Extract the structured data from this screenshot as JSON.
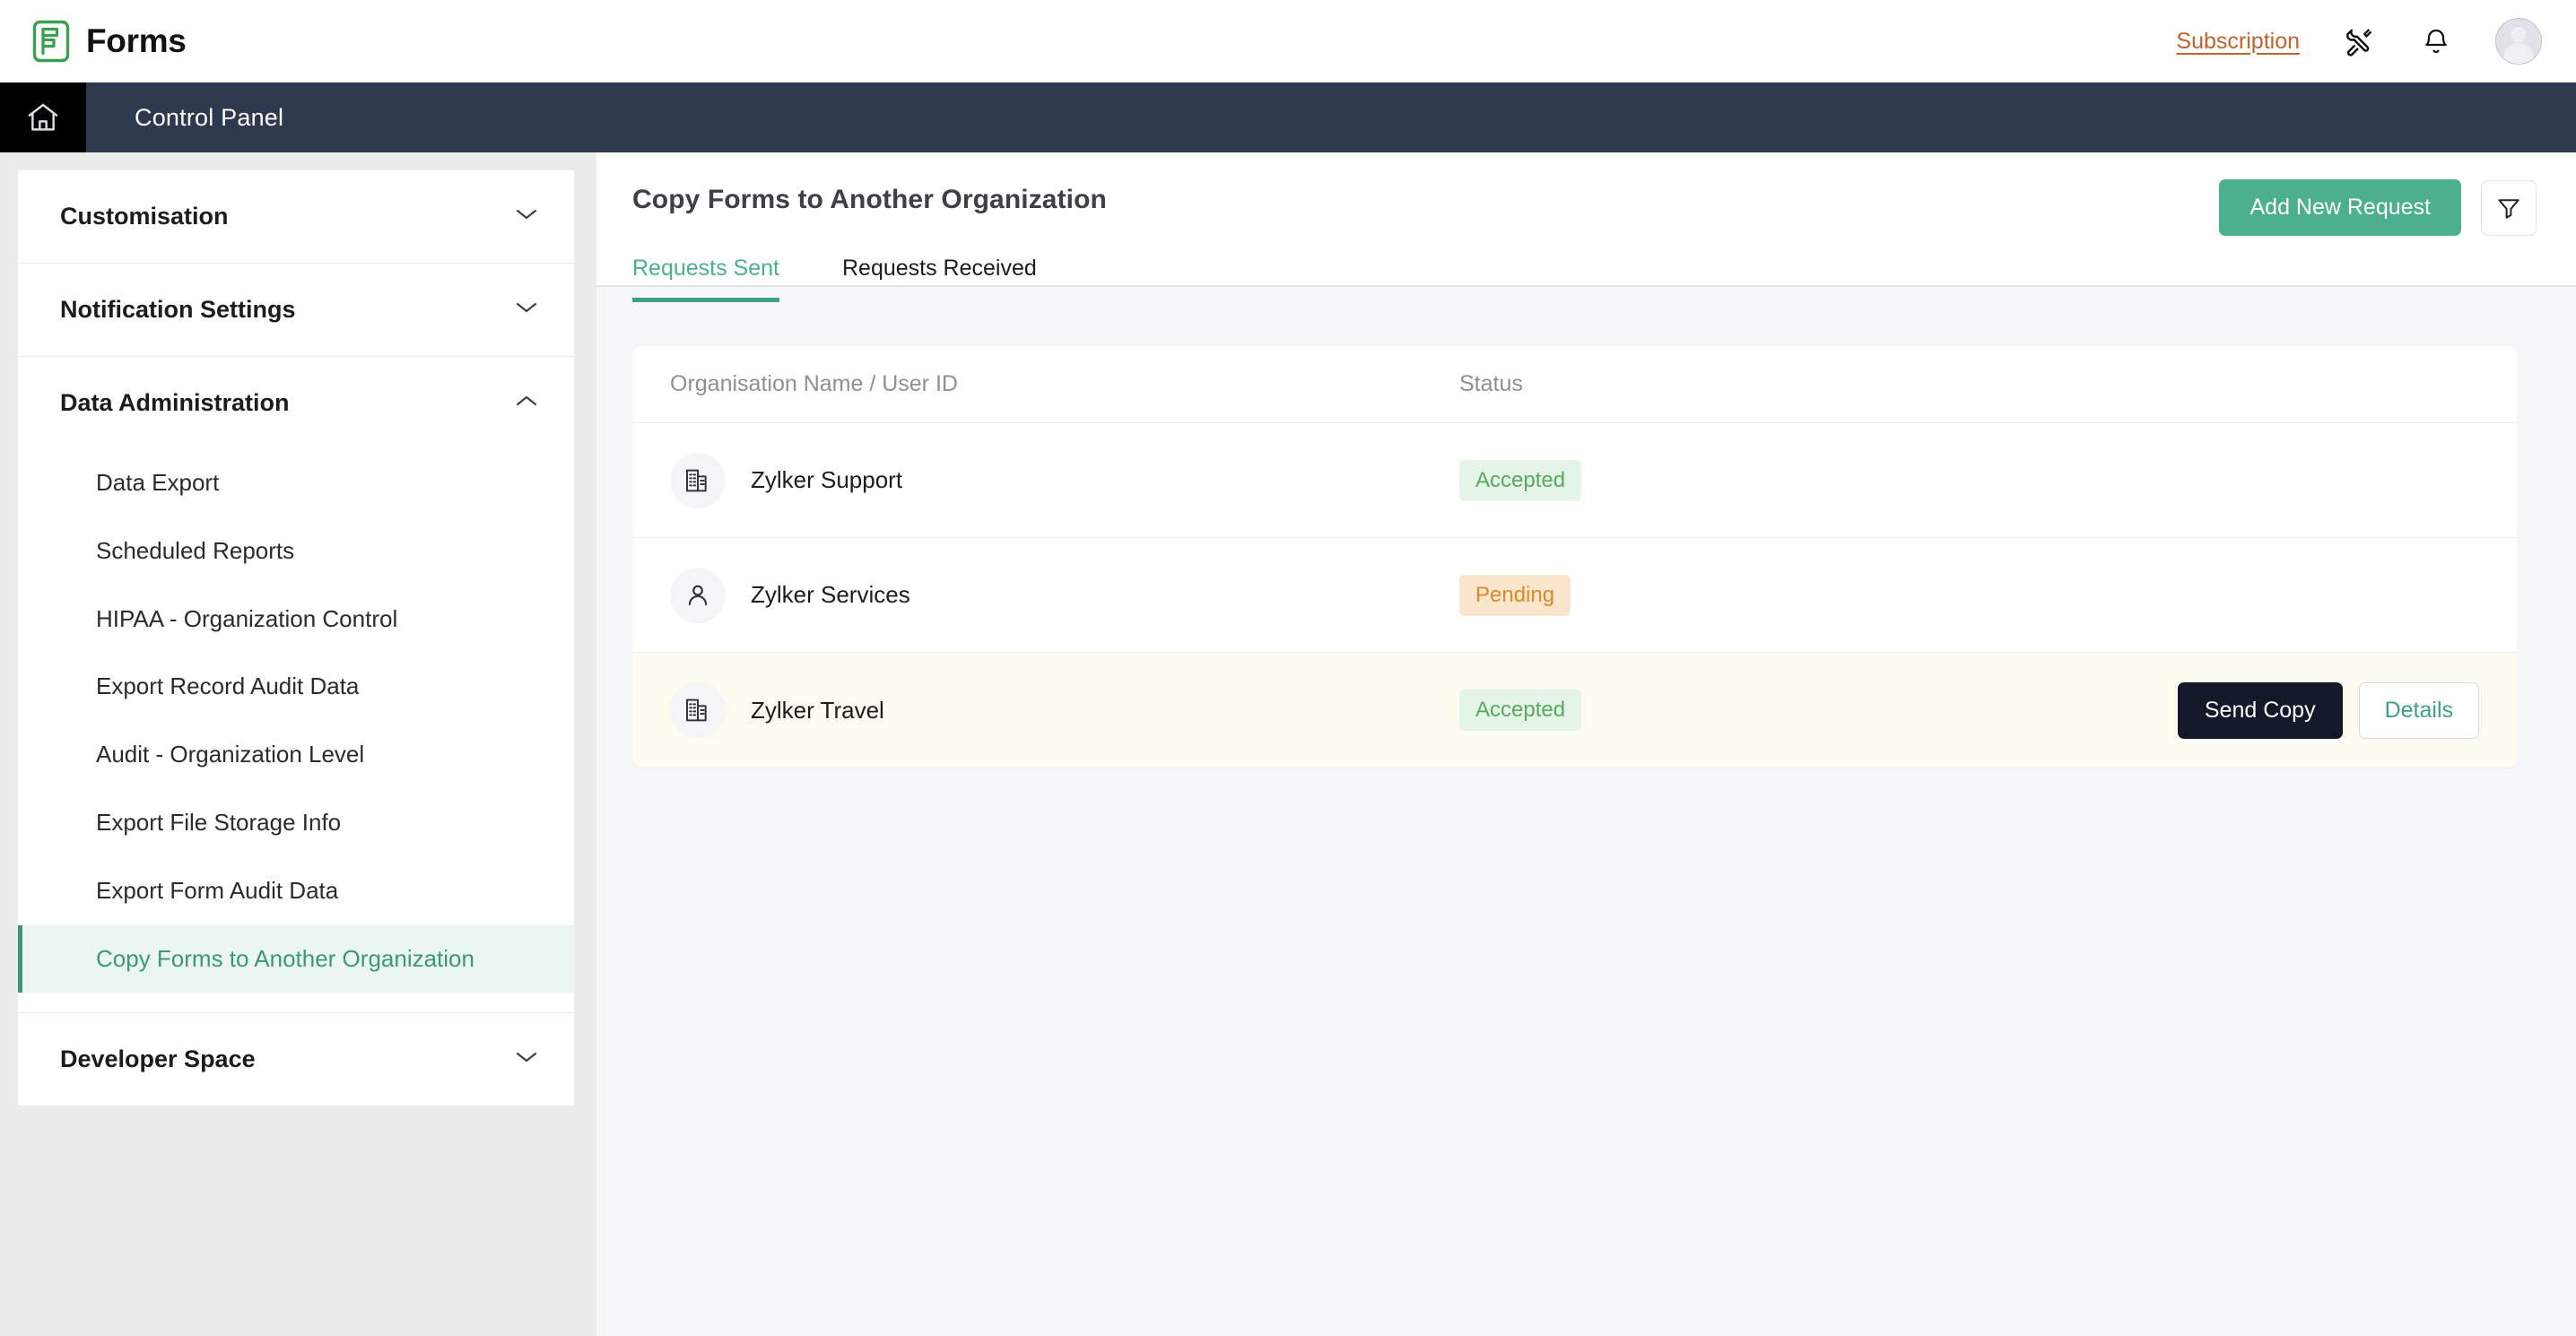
{
  "app": {
    "name": "Forms",
    "logo_icon": "forms-logo-icon"
  },
  "topbar": {
    "subscription_label": "Subscription",
    "tools_icon": "tools-icon",
    "notifications_icon": "bell-icon",
    "avatar_icon": "user-avatar"
  },
  "controlbar": {
    "home_icon": "home-icon",
    "title": "Control Panel"
  },
  "sidebar": {
    "groups": [
      {
        "label": "Customisation",
        "expanded": false,
        "chevron": "chevron-down-icon",
        "items": []
      },
      {
        "label": "Notification Settings",
        "expanded": false,
        "chevron": "chevron-down-icon",
        "items": []
      },
      {
        "label": "Data Administration",
        "expanded": true,
        "chevron": "chevron-up-icon",
        "items": [
          {
            "label": "Data Export",
            "active": false
          },
          {
            "label": "Scheduled Reports",
            "active": false
          },
          {
            "label": "HIPAA - Organization Control",
            "active": false
          },
          {
            "label": "Export Record Audit Data",
            "active": false
          },
          {
            "label": "Audit - Organization Level",
            "active": false
          },
          {
            "label": "Export File Storage Info",
            "active": false
          },
          {
            "label": "Export Form Audit Data",
            "active": false
          },
          {
            "label": "Copy Forms to Another Organization",
            "active": true
          }
        ]
      },
      {
        "label": "Developer Space",
        "expanded": false,
        "chevron": "chevron-down-icon",
        "items": []
      }
    ]
  },
  "main": {
    "page_title": "Copy Forms to Another Organization",
    "add_button_label": "Add New Request",
    "filter_icon": "filter-funnel-icon",
    "tabs": [
      {
        "label": "Requests Sent",
        "active": true
      },
      {
        "label": "Requests Received",
        "active": false
      }
    ],
    "table": {
      "columns": [
        "Organisation Name / User ID",
        "Status"
      ],
      "rows": [
        {
          "icon": "building-icon",
          "name": "Zylker Support",
          "status": "Accepted",
          "status_type": "accepted",
          "actions": []
        },
        {
          "icon": "person-icon",
          "name": "Zylker Services",
          "status": "Pending",
          "status_type": "pending",
          "actions": []
        },
        {
          "icon": "building-icon",
          "name": "Zylker Travel",
          "status": "Accepted",
          "status_type": "accepted",
          "highlighted": true,
          "actions": [
            {
              "label": "Send Copy",
              "style": "dark"
            },
            {
              "label": "Details",
              "style": "ghost"
            }
          ]
        }
      ]
    }
  },
  "colors": {
    "brand_green": "#4caf8e",
    "navy_bar": "#2e3950",
    "subscription_orange": "#c0632a",
    "accepted_bg": "#e4f4e6",
    "accepted_text": "#5aa75f",
    "pending_bg": "#fbe5cd",
    "pending_text": "#d98a2b",
    "dark_button": "#14192a",
    "row_highlight": "#fdfaf0",
    "active_sidebar_bg": "#eaf6ef"
  }
}
